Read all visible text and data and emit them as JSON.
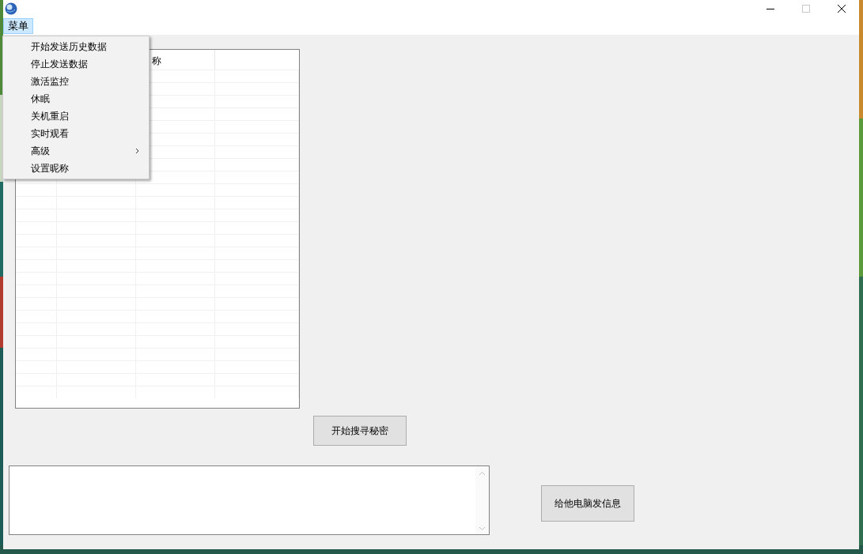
{
  "window": {
    "title_buttons": [
      {
        "kind": "minimize",
        "disabled": false
      },
      {
        "kind": "maximize",
        "disabled": true
      },
      {
        "kind": "close",
        "disabled": false
      }
    ]
  },
  "menu_bar": [
    {
      "label": "菜单",
      "selected": true
    }
  ],
  "menu": {
    "items": [
      {
        "label": "开始发送历史数据",
        "has_submenu": false
      },
      {
        "label": "停止发送数据",
        "has_submenu": false
      },
      {
        "label": "激活监控",
        "has_submenu": false
      },
      {
        "label": "休眠",
        "has_submenu": false
      },
      {
        "label": "关机重启",
        "has_submenu": false
      },
      {
        "label": "实时观看",
        "has_submenu": false
      },
      {
        "label": "高级",
        "has_submenu": true
      },
      {
        "label": "设置昵称",
        "has_submenu": false
      }
    ]
  },
  "list": {
    "column_3": {
      "label": "称"
    }
  },
  "search_button": {
    "label": "开始搜寻秘密"
  },
  "message_box": {
    "scrollbar": true
  },
  "send_button": {
    "label": "给他电脑发信息"
  }
}
